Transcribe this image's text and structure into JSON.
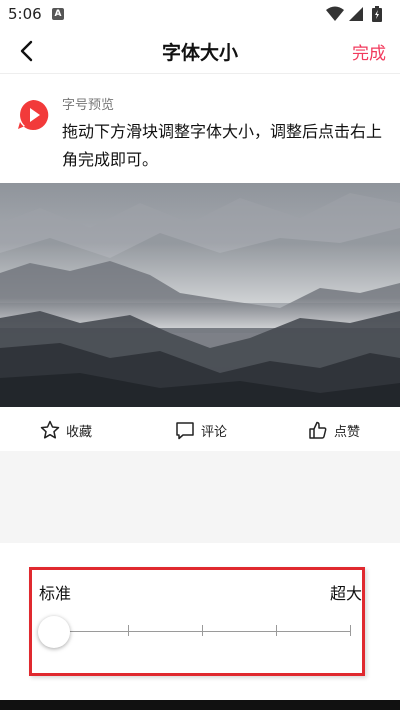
{
  "status_bar": {
    "time": "5:06",
    "notification": "A"
  },
  "header": {
    "title": "字体大小",
    "done_label": "完成"
  },
  "preview": {
    "label": "字号预览",
    "text": "拖动下方滑块调整字体大小，调整后点击右上角完成即可。"
  },
  "actions": [
    {
      "label": "收藏",
      "icon": "star-icon"
    },
    {
      "label": "评论",
      "icon": "comment-icon"
    },
    {
      "label": "点赞",
      "icon": "thumbs-up-icon"
    }
  ],
  "font_slider": {
    "min_label": "标准",
    "max_label": "超大",
    "steps": 5,
    "selected_index": 0
  },
  "colors": {
    "accent": "#f23a5d",
    "highlight_border": "#e0292f"
  }
}
